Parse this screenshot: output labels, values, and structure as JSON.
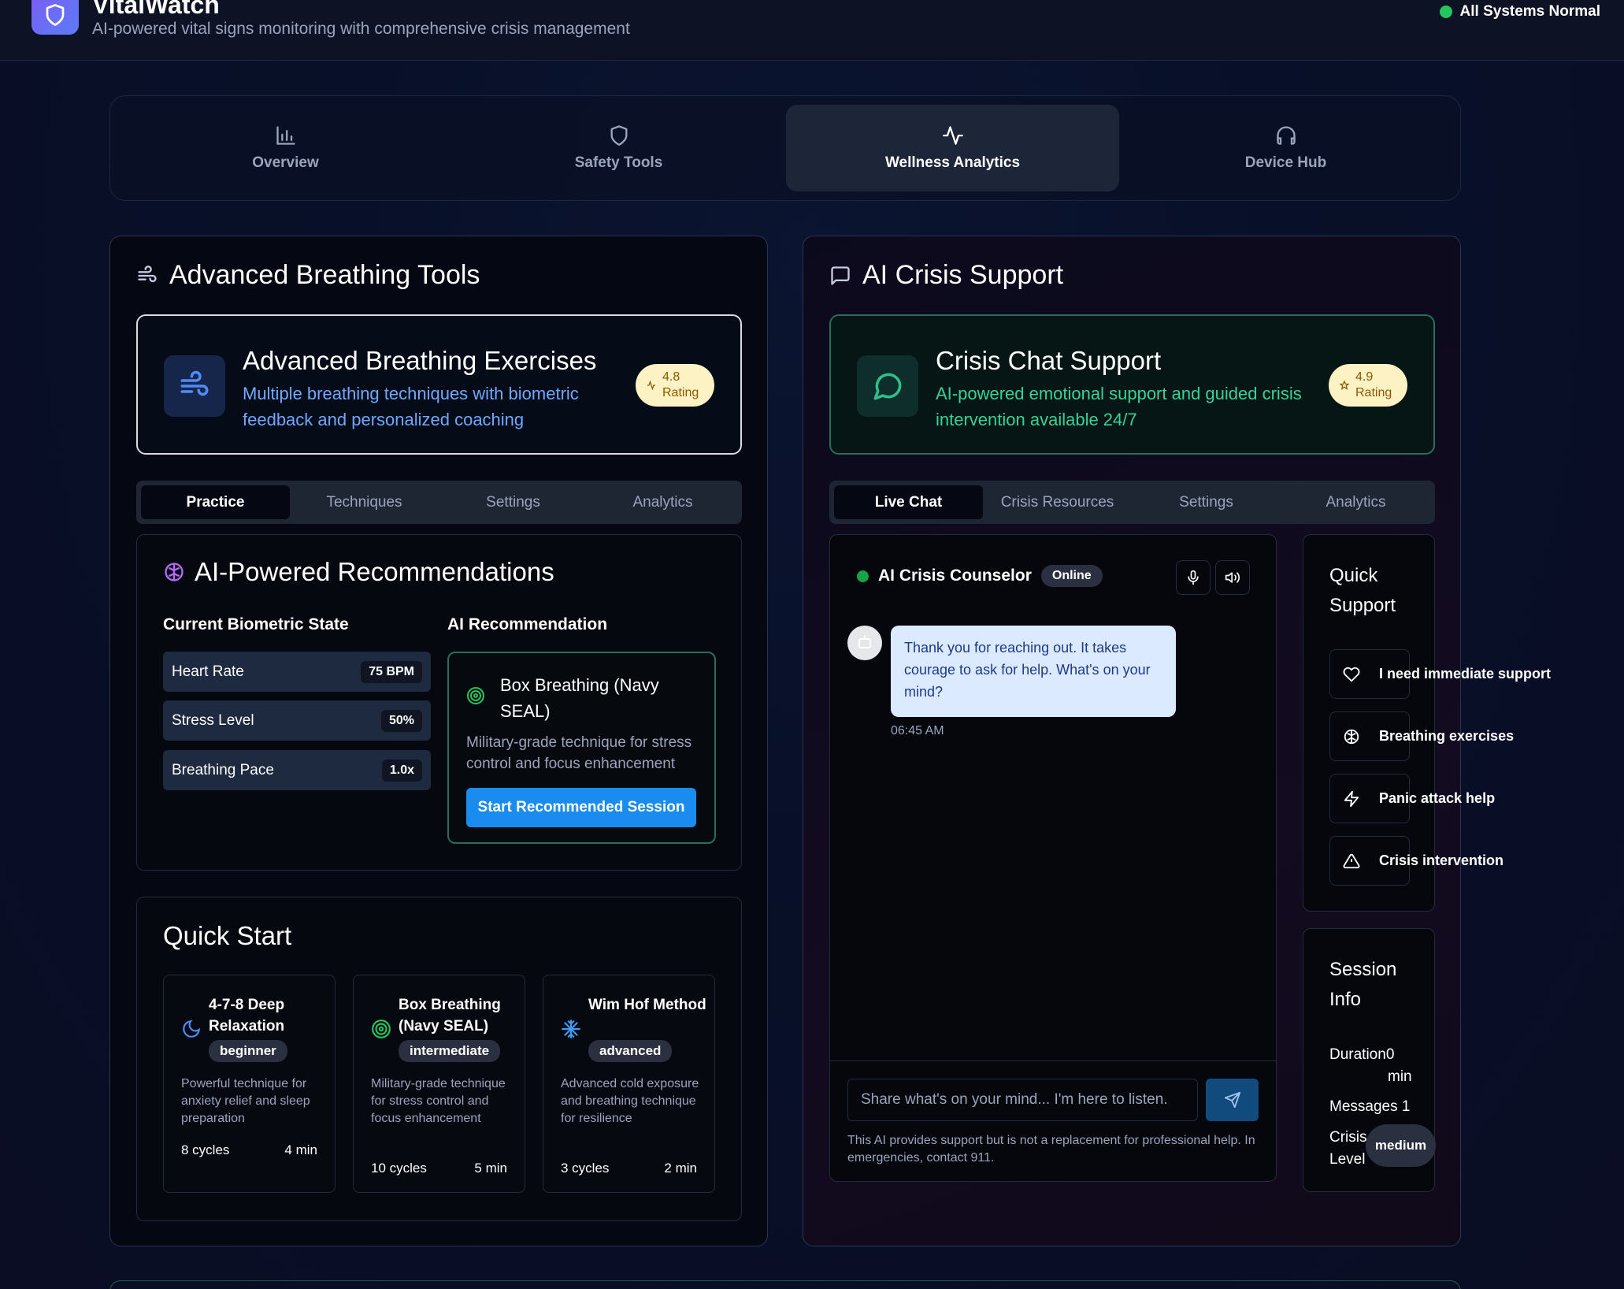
{
  "header": {
    "app_name": "VitalWatch",
    "subtitle": "AI-powered vital signs monitoring with comprehensive crisis management",
    "status": "All Systems Normal"
  },
  "nav": {
    "tabs": [
      {
        "label": "Overview",
        "icon": "bar-chart-icon"
      },
      {
        "label": "Safety Tools",
        "icon": "shield-icon"
      },
      {
        "label": "Wellness Analytics",
        "icon": "activity-icon",
        "active": true
      },
      {
        "label": "Device Hub",
        "icon": "headphones-icon"
      }
    ]
  },
  "breathing": {
    "panel_title": "Advanced Breathing Tools",
    "feature": {
      "title": "Advanced Breathing Exercises",
      "description": "Multiple breathing techniques with biometric feedback and personalized coaching",
      "rating_value": "4.8",
      "rating_label": "Rating"
    },
    "tabs": [
      "Practice",
      "Techniques",
      "Settings",
      "Analytics"
    ],
    "recommendations": {
      "title": "AI-Powered Recommendations",
      "biometric_heading": "Current Biometric State",
      "metrics": [
        {
          "label": "Heart Rate",
          "value": "75 BPM"
        },
        {
          "label": "Stress Level",
          "value": "50%"
        },
        {
          "label": "Breathing Pace",
          "value": "1.0x"
        }
      ],
      "ai_heading": "AI Recommendation",
      "ai_title": "Box Breathing (Navy SEAL)",
      "ai_description": "Military-grade technique for stress control and focus enhancement",
      "ai_button": "Start Recommended Session"
    },
    "quick_start": {
      "title": "Quick Start",
      "items": [
        {
          "name": "4-7-8 Deep Relaxation",
          "level": "beginner",
          "description": "Powerful technique for anxiety relief and sleep preparation",
          "cycles": "8 cycles",
          "duration": "4 min",
          "icon": "moon-icon"
        },
        {
          "name": "Box Breathing (Navy SEAL)",
          "level": "intermediate",
          "description": "Military-grade technique for stress control and focus enhancement",
          "cycles": "10 cycles",
          "duration": "5 min",
          "icon": "target-icon"
        },
        {
          "name": "Wim Hof Method",
          "level": "advanced",
          "description": "Advanced cold exposure and breathing technique for resilience",
          "cycles": "3 cycles",
          "duration": "2 min",
          "icon": "snowflake-icon"
        }
      ]
    }
  },
  "crisis": {
    "panel_title": "AI Crisis Support",
    "feature": {
      "title": "Crisis Chat Support",
      "description": "AI-powered emotional support and guided crisis intervention available 24/7",
      "rating_value": "4.9",
      "rating_label": "Rating"
    },
    "tabs": [
      "Live Chat",
      "Crisis Resources",
      "Settings",
      "Analytics"
    ],
    "chat": {
      "counselor": "AI Crisis Counselor",
      "status": "Online",
      "message": "Thank you for reaching out. It takes courage to ask for help. What's on your mind?",
      "time": "06:45 AM",
      "placeholder": "Share what's on your mind... I'm here to listen.",
      "disclaimer": "This AI provides support but is not a replacement for professional help. In emergencies, contact 911."
    },
    "quick_support": {
      "title": "Quick Support",
      "items": [
        {
          "label": "I need immediate support",
          "icon": "heart-icon"
        },
        {
          "label": "Breathing exercises",
          "icon": "brain-icon"
        },
        {
          "label": "Panic attack help",
          "icon": "zap-icon"
        },
        {
          "label": "Crisis intervention",
          "icon": "alert-triangle-icon"
        }
      ]
    },
    "session_info": {
      "title": "Session Info",
      "duration_label": "Duration",
      "duration_value": "0",
      "duration_unit": "min",
      "messages_label": "Messages",
      "messages_value": "1",
      "crisis_label_1": "Crisis",
      "crisis_label_2": "Level",
      "crisis_level": "medium"
    }
  }
}
